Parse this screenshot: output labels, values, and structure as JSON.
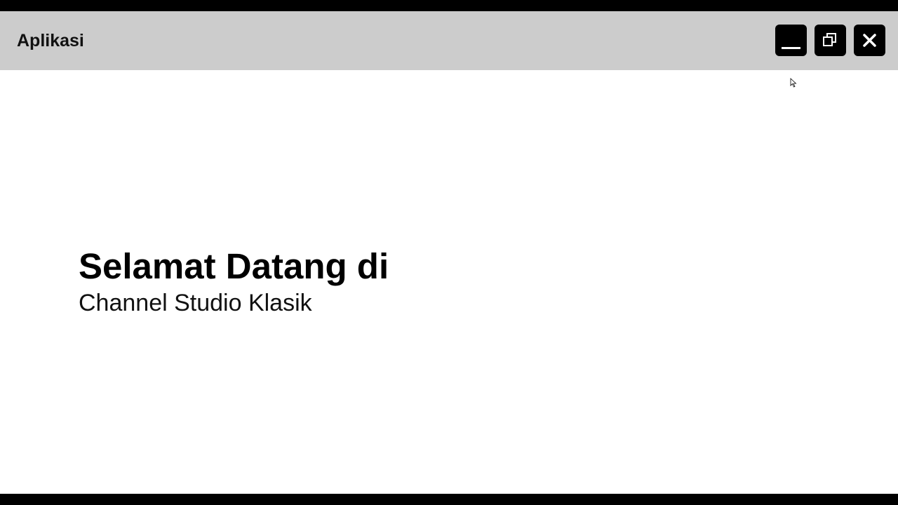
{
  "window": {
    "title": "Aplikasi",
    "controls": {
      "minimize_icon": "minimize-icon",
      "restore_icon": "restore-icon",
      "close_icon": "close-icon"
    }
  },
  "main": {
    "heading": "Selamat Datang di",
    "subheading": "Channel Studio Klasik"
  },
  "colors": {
    "titlebar": "#cccccc",
    "background": "#ffffff",
    "button": "#000000",
    "text": "#000000"
  }
}
